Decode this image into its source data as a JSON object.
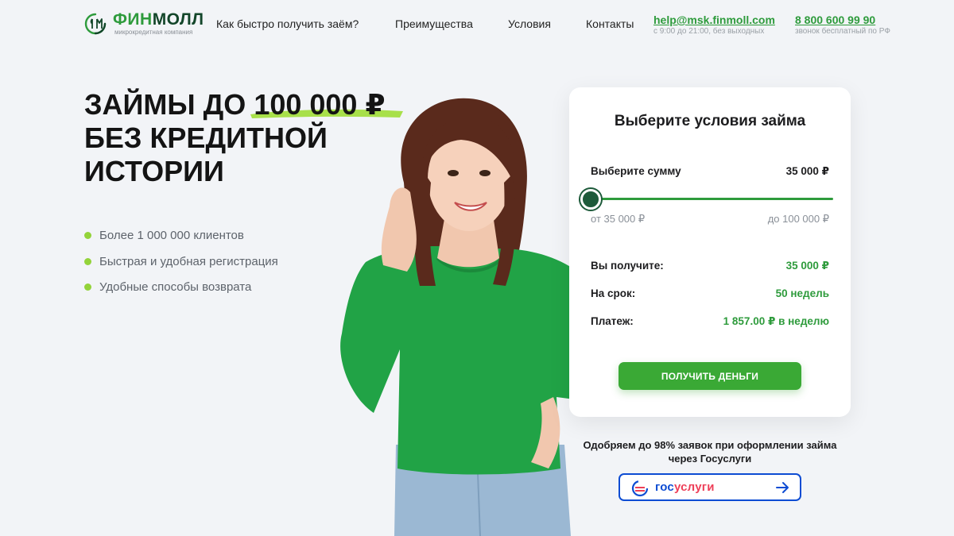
{
  "header": {
    "logo": {
      "name_part1": "ФИН",
      "name_part2": "МОЛЛ",
      "subtitle": "микрокредитная компания"
    },
    "nav": [
      {
        "label": "Как быстро получить заём?"
      },
      {
        "label": "Преимущества"
      },
      {
        "label": "Условия"
      },
      {
        "label": "Контакты"
      }
    ],
    "email": {
      "value": "help@msk.finmoll.com",
      "note": "с 9:00 до 21:00, без выходных"
    },
    "phone": {
      "value": "8 800 600 99 90",
      "note": "звонок бесплатный по РФ"
    }
  },
  "hero": {
    "headline_prefix": "ЗАЙМЫ ДО ",
    "headline_amount": "100 000 ₽",
    "headline_line2": "БЕЗ КРЕДИТНОЙ",
    "headline_line3": "ИСТОРИИ",
    "bullets": [
      "Более 1 000 000 клиентов",
      "Быстрая и удобная регистрация",
      "Удобные способы возврата"
    ]
  },
  "loan_card": {
    "title": "Выберите условия займа",
    "amount_label": "Выберите сумму",
    "amount_value": "35 000 ₽",
    "slider_position": 0,
    "range_min": "от 35 000 ₽",
    "range_max": "до 100 000 ₽",
    "receive_label": "Вы получите:",
    "receive_value": "35 000 ₽",
    "term_label": "На срок:",
    "term_value": "50 недель",
    "payment_label": "Платеж:",
    "payment_value": "1 857.00 ₽ в неделю",
    "cta_label": "ПОЛУЧИТЬ ДЕНЬГИ"
  },
  "gosuslugi": {
    "approval_text": "Одобряем до 98% заявок при оформлении займа через Госуслуги",
    "button_part1": "гос",
    "button_part2": "услуги"
  },
  "colors": {
    "brand_green": "#2e9b3c",
    "dark_green": "#13462a",
    "bullet_green": "#93d33a",
    "button_green": "#3aa935",
    "gosuslugi_blue": "#0d4cd3",
    "gosuslugi_red": "#ee3f58"
  },
  "icons": {
    "logo_mark": "finmoll-logo-icon",
    "gosuslugi_logo": "gosuslugi-logo-icon",
    "arrow": "arrow-right-icon"
  }
}
